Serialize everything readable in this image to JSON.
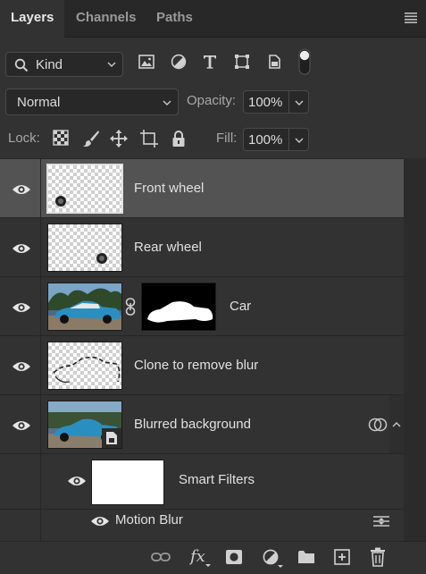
{
  "tabs": [
    {
      "label": "Layers"
    },
    {
      "label": "Channels"
    },
    {
      "label": "Paths"
    }
  ],
  "filter": {
    "kind_label": "Kind",
    "filter_icons": [
      "image-filter-icon",
      "adjustment-filter-icon",
      "type-filter-icon",
      "shape-filter-icon",
      "smart-object-filter-icon",
      "filter-toggle-switch"
    ]
  },
  "blend": {
    "mode": "Normal",
    "opacity_label": "Opacity:",
    "opacity_value": "100%"
  },
  "lock": {
    "label": "Lock:",
    "fill_label": "Fill:",
    "fill_value": "100%",
    "lock_icons": [
      "lock-transparent-pixels-icon",
      "lock-image-pixels-icon",
      "lock-position-icon",
      "lock-artboard-icon",
      "lock-all-icon"
    ]
  },
  "layers": [
    {
      "name": "Front wheel",
      "selected": true
    },
    {
      "name": "Rear wheel",
      "selected": false
    },
    {
      "name": "Car",
      "selected": false
    },
    {
      "name": "Clone to remove blur",
      "selected": false
    },
    {
      "name": "Blurred background",
      "selected": false
    }
  ],
  "smart_filters": {
    "label": "Smart Filters",
    "filters": [
      {
        "name": "Motion Blur"
      }
    ]
  },
  "bottom_icons": [
    "link-layers-icon",
    "fx-icon",
    "add-mask-icon",
    "adjustment-layer-icon",
    "new-group-icon",
    "new-layer-icon",
    "delete-layer-icon"
  ],
  "colors": {
    "panel": "#323232",
    "selected_row": "#535353",
    "text": "#e0e0e0"
  }
}
